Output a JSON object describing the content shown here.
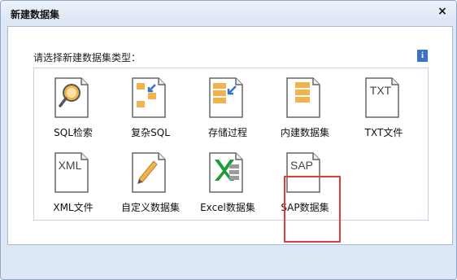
{
  "dialog": {
    "title": "新建数据集",
    "close_label": "×",
    "prompt": "请选择新建数据集类型："
  },
  "items": [
    {
      "label": "SQL检索",
      "icon": "sql-search-icon"
    },
    {
      "label": "复杂SQL",
      "icon": "complex-sql-icon"
    },
    {
      "label": "存储过程",
      "icon": "stored-procedure-icon"
    },
    {
      "label": "内建数据集",
      "icon": "builtin-dataset-icon"
    },
    {
      "label": "TXT文件",
      "icon": "txt-file-icon",
      "badge": "TXT"
    },
    {
      "label": "XML文件",
      "icon": "xml-file-icon",
      "badge": "XML"
    },
    {
      "label": "自定义数据集",
      "icon": "custom-dataset-icon"
    },
    {
      "label": "Excel数据集",
      "icon": "excel-dataset-icon"
    },
    {
      "label": "SAP数据集",
      "icon": "sap-dataset-icon",
      "badge": "SAP",
      "selected": true
    }
  ],
  "colors": {
    "accent": "#3a72c7",
    "selection": "#e33a3a",
    "icon_orange": "#f2b24c",
    "excel_green": "#1e9b3a"
  }
}
